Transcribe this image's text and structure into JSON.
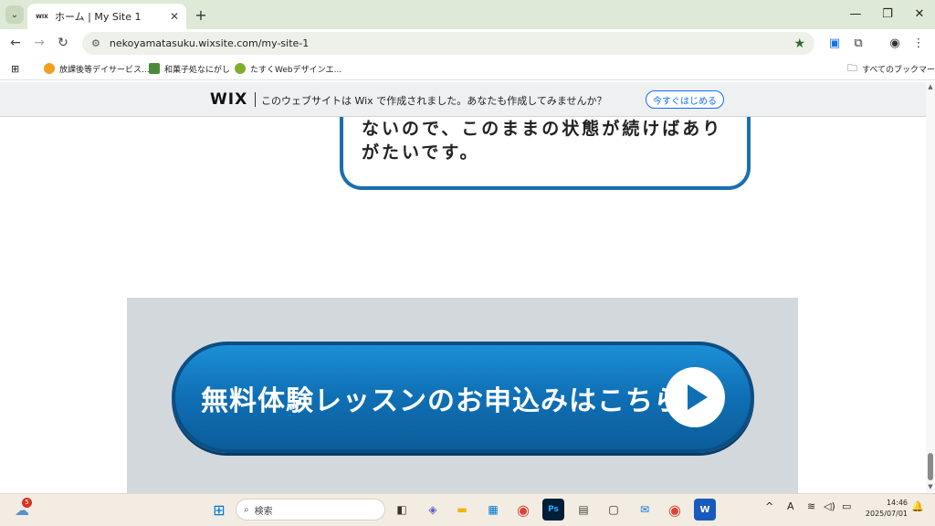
{
  "browser": {
    "tab": {
      "title": "ホーム | My Site 1",
      "favicon_text": "WIX"
    },
    "url": "nekoyamatasuku.wixsite.com/my-site-1",
    "bookmarks": [
      {
        "label": "放課後等デイサービス...",
        "color": "#f0a020"
      },
      {
        "label": "和菓子処なにがし",
        "color": "#4a8a3a"
      },
      {
        "label": "たすくWebデザインエ...",
        "color": "#7fae2e"
      }
    ],
    "all_bookmarks": "すべてのブックマーク"
  },
  "wix_banner": {
    "logo": "WIX",
    "text": "このウェブサイトは Wix で作成されました。あなたも作成してみませんか？",
    "button": "今すぐはじめる"
  },
  "page": {
    "bubble_lines": [
      "ないので、このままの状態が続けばあり",
      "がたいです。"
    ],
    "cta_label": "無料体験レッスンのお申込みはこちら"
  },
  "taskbar": {
    "weather_badge": "5",
    "search_placeholder": "検索",
    "time": "14:46",
    "date": "2025/07/01"
  }
}
